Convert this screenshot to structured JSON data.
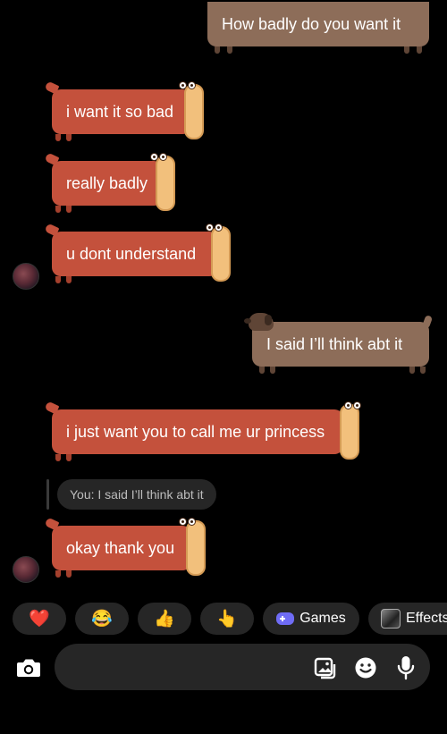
{
  "messages": [
    {
      "dir": "out",
      "text": "How badly do you want it"
    },
    {
      "dir": "in",
      "text": "i want it so bad"
    },
    {
      "dir": "in",
      "text": "really badly"
    },
    {
      "dir": "in",
      "text": "u dont understand"
    },
    {
      "dir": "out",
      "text": "I said I’ll think abt it"
    },
    {
      "dir": "in",
      "text": "i just want you to call me ur princess"
    },
    {
      "dir": "in",
      "text": "okay thank you"
    }
  ],
  "reply_preview": "You: I said I’ll think abt it",
  "quick_actions": {
    "reactions": [
      "❤️",
      "😂",
      "👍",
      "👆"
    ],
    "games_label": "Games",
    "effects_label": "Effects"
  },
  "composer": {
    "placeholder": "",
    "icons": [
      "camera-icon",
      "gallery-icon",
      "sticker-icon",
      "microphone-icon"
    ]
  },
  "colors": {
    "incoming_bubble": "#c4513c",
    "outgoing_bubble": "#8d6d59",
    "background": "#000000",
    "accent_games": "#6f6cf5"
  }
}
